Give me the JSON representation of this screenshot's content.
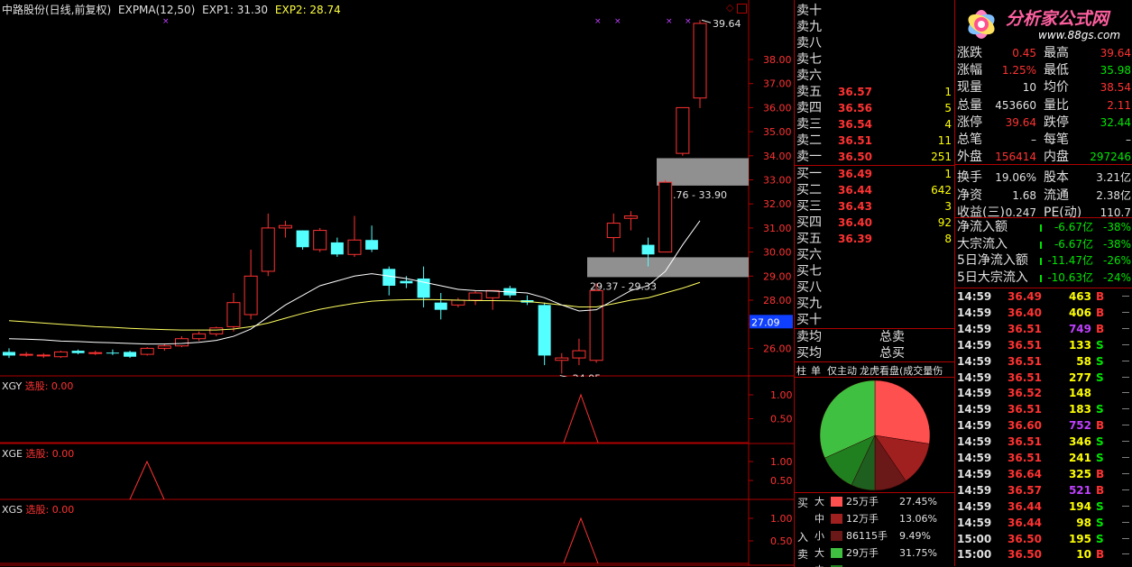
{
  "header": {
    "stock": "中路股份(日线,前复权)",
    "indicator": "EXPMA(12,50)",
    "exp1": "EXP1: 31.30",
    "exp2": "EXP2: 28.74"
  },
  "chart": {
    "price_ticks": [
      "38.00",
      "37.00",
      "36.00",
      "35.00",
      "34.00",
      "33.00",
      "32.00",
      "31.00",
      "30.00",
      "29.00",
      "28.00",
      "27.00",
      "26.00"
    ],
    "last_price_tag": "27.09",
    "annotations": {
      "high": "39.64",
      "low": "24.95",
      "zone1": "32.76 - 33.90",
      "zone2": "29.37 - 29.33"
    }
  },
  "subcharts": [
    {
      "name": "XGY",
      "label": "选股: 0.00",
      "ticks": [
        "1.00",
        "0.50"
      ]
    },
    {
      "name": "XGE",
      "label": "选股: 0.00",
      "ticks": [
        "1.00",
        "0.50"
      ]
    },
    {
      "name": "XGS",
      "label": "选股: 0.00",
      "ticks": [
        "1.00",
        "0.50"
      ]
    }
  ],
  "orderbook": {
    "sells": [
      {
        "label": "卖十",
        "price": "",
        "vol": ""
      },
      {
        "label": "卖九",
        "price": "",
        "vol": ""
      },
      {
        "label": "卖八",
        "price": "",
        "vol": ""
      },
      {
        "label": "卖七",
        "price": "",
        "vol": ""
      },
      {
        "label": "卖六",
        "price": "",
        "vol": ""
      },
      {
        "label": "卖五",
        "price": "36.57",
        "vol": "1"
      },
      {
        "label": "卖四",
        "price": "36.56",
        "vol": "5"
      },
      {
        "label": "卖三",
        "price": "36.54",
        "vol": "4"
      },
      {
        "label": "卖二",
        "price": "36.51",
        "vol": "11"
      },
      {
        "label": "卖一",
        "price": "36.50",
        "vol": "251"
      }
    ],
    "buys": [
      {
        "label": "买一",
        "price": "36.49",
        "vol": "1"
      },
      {
        "label": "买二",
        "price": "36.44",
        "vol": "642"
      },
      {
        "label": "买三",
        "price": "36.43",
        "vol": "3"
      },
      {
        "label": "买四",
        "price": "36.40",
        "vol": "92"
      },
      {
        "label": "买五",
        "price": "36.39",
        "vol": "8"
      },
      {
        "label": "买六",
        "price": "",
        "vol": ""
      },
      {
        "label": "买七",
        "price": "",
        "vol": ""
      },
      {
        "label": "买八",
        "price": "",
        "vol": ""
      },
      {
        "label": "买九",
        "price": "",
        "vol": ""
      },
      {
        "label": "买十",
        "price": "",
        "vol": ""
      }
    ],
    "avg": [
      {
        "label": "卖均",
        "total": "总卖"
      },
      {
        "label": "买均",
        "total": "总买"
      }
    ],
    "tabs": [
      "柱",
      "单",
      "仅主动",
      "龙虎看盘(成交量伤"
    ]
  },
  "pie": {
    "buy_label": "买",
    "in_label": "入",
    "sell_label": "卖",
    "legend": [
      {
        "size": "大",
        "name": "25万手",
        "pct": "27.45%",
        "color": "#ff5050"
      },
      {
        "size": "中",
        "name": "12万手",
        "pct": "13.06%",
        "color": "#a02020"
      },
      {
        "size": "小",
        "name": "86115手",
        "pct": "9.49%",
        "color": "#6a1818"
      },
      {
        "size": "大",
        "name": "29万手",
        "pct": "31.75%",
        "color": "#40c040"
      },
      {
        "size": "中",
        "name": "",
        "pct": "",
        "color": "#208020"
      }
    ],
    "slices": [
      27.45,
      13.06,
      9.49,
      7.0,
      11.25,
      31.75
    ]
  },
  "logo": {
    "text": "分析家公式网",
    "url": "www.88gs.com"
  },
  "stats": [
    {
      "l1": "涨跌",
      "v1": "0.45",
      "l2": "最高",
      "v2": "39.64",
      "c1": "red",
      "c2": "red"
    },
    {
      "l1": "涨幅",
      "v1": "1.25%",
      "l2": "最低",
      "v2": "35.98",
      "c1": "red",
      "c2": "green"
    },
    {
      "l1": "现量",
      "v1": "10",
      "l2": "均价",
      "v2": "38.54",
      "c1": "white",
      "c2": "red"
    },
    {
      "l1": "总量",
      "v1": "453660",
      "l2": "量比",
      "v2": "2.11",
      "c1": "white",
      "c2": "red"
    },
    {
      "l1": "涨停",
      "v1": "39.64",
      "l2": "跌停",
      "v2": "32.44",
      "c1": "red",
      "c2": "green"
    },
    {
      "l1": "总笔",
      "v1": "–",
      "l2": "每笔",
      "v2": "–",
      "c1": "white",
      "c2": "white"
    },
    {
      "l1": "外盘",
      "v1": "156414",
      "l2": "内盘",
      "v2": "297246",
      "c1": "red",
      "c2": "green"
    },
    {
      "l1": "换手",
      "v1": "19.06%",
      "l2": "股本",
      "v2": "3.21亿",
      "c1": "white",
      "c2": "white"
    },
    {
      "l1": "净资",
      "v1": "1.68",
      "l2": "流通",
      "v2": "2.38亿",
      "c1": "white",
      "c2": "white"
    },
    {
      "l1": "收益(三)",
      "v1": "0.247",
      "l2": "PE(动)",
      "v2": "110.7",
      "c1": "white",
      "c2": "white"
    }
  ],
  "flows": [
    {
      "label": "净流入额",
      "value": "-6.67亿",
      "pct": "-38%"
    },
    {
      "label": "大宗流入",
      "value": "-6.67亿",
      "pct": "-38%"
    },
    {
      "label": "5日净流入额",
      "value": "-11.47亿",
      "pct": "-26%"
    },
    {
      "label": "5日大宗流入",
      "value": "-10.63亿",
      "pct": "-24%"
    }
  ],
  "ticks": [
    {
      "t": "14:59",
      "p": "36.49",
      "v": "463",
      "s": "B",
      "pc": "red",
      "vc": "yellow"
    },
    {
      "t": "14:59",
      "p": "36.40",
      "v": "406",
      "s": "B",
      "pc": "red",
      "vc": "yellow"
    },
    {
      "t": "14:59",
      "p": "36.51",
      "v": "749",
      "s": "B",
      "pc": "red",
      "vc": "magenta"
    },
    {
      "t": "14:59",
      "p": "36.51",
      "v": "133",
      "s": "S",
      "pc": "red",
      "vc": "yellow"
    },
    {
      "t": "14:59",
      "p": "36.51",
      "v": "58",
      "s": "S",
      "pc": "red",
      "vc": "yellow"
    },
    {
      "t": "14:59",
      "p": "36.51",
      "v": "277",
      "s": "S",
      "pc": "red",
      "vc": "yellow"
    },
    {
      "t": "14:59",
      "p": "36.52",
      "v": "148",
      "s": "",
      "pc": "red",
      "vc": "yellow"
    },
    {
      "t": "14:59",
      "p": "36.51",
      "v": "183",
      "s": "S",
      "pc": "red",
      "vc": "yellow"
    },
    {
      "t": "14:59",
      "p": "36.60",
      "v": "752",
      "s": "B",
      "pc": "red",
      "vc": "magenta"
    },
    {
      "t": "14:59",
      "p": "36.51",
      "v": "346",
      "s": "S",
      "pc": "red",
      "vc": "yellow"
    },
    {
      "t": "14:59",
      "p": "36.51",
      "v": "241",
      "s": "S",
      "pc": "red",
      "vc": "yellow"
    },
    {
      "t": "14:59",
      "p": "36.64",
      "v": "325",
      "s": "B",
      "pc": "red",
      "vc": "yellow"
    },
    {
      "t": "14:59",
      "p": "36.57",
      "v": "521",
      "s": "B",
      "pc": "red",
      "vc": "magenta"
    },
    {
      "t": "14:59",
      "p": "36.44",
      "v": "194",
      "s": "S",
      "pc": "red",
      "vc": "yellow"
    },
    {
      "t": "14:59",
      "p": "36.44",
      "v": "98",
      "s": "S",
      "pc": "red",
      "vc": "yellow"
    },
    {
      "t": "15:00",
      "p": "36.50",
      "v": "195",
      "s": "S",
      "pc": "red",
      "vc": "yellow"
    },
    {
      "t": "15:00",
      "p": "36.50",
      "v": "10",
      "s": "B",
      "pc": "red",
      "vc": "yellow"
    }
  ],
  "candles": [
    {
      "o": 25.85,
      "h": 26.0,
      "l": 25.6,
      "c": 25.7
    },
    {
      "o": 25.75,
      "h": 25.85,
      "l": 25.65,
      "c": 25.75
    },
    {
      "o": 25.7,
      "h": 25.8,
      "l": 25.6,
      "c": 25.72
    },
    {
      "o": 25.65,
      "h": 25.9,
      "l": 25.6,
      "c": 25.85
    },
    {
      "o": 25.9,
      "h": 25.95,
      "l": 25.75,
      "c": 25.8
    },
    {
      "o": 25.8,
      "h": 25.9,
      "l": 25.72,
      "c": 25.82
    },
    {
      "o": 25.82,
      "h": 25.95,
      "l": 25.72,
      "c": 25.8
    },
    {
      "o": 25.85,
      "h": 25.9,
      "l": 25.6,
      "c": 25.65
    },
    {
      "o": 25.75,
      "h": 26.05,
      "l": 25.7,
      "c": 26.0
    },
    {
      "o": 26.0,
      "h": 26.2,
      "l": 25.9,
      "c": 26.1
    },
    {
      "o": 26.1,
      "h": 26.5,
      "l": 26.05,
      "c": 26.4
    },
    {
      "o": 26.4,
      "h": 26.7,
      "l": 26.3,
      "c": 26.6
    },
    {
      "o": 26.6,
      "h": 26.9,
      "l": 26.5,
      "c": 26.85
    },
    {
      "o": 26.9,
      "h": 28.3,
      "l": 26.7,
      "c": 27.9
    },
    {
      "o": 27.4,
      "h": 30.1,
      "l": 27.2,
      "c": 29.0
    },
    {
      "o": 29.2,
      "h": 31.6,
      "l": 29.0,
      "c": 31.0
    },
    {
      "o": 31.0,
      "h": 31.3,
      "l": 30.6,
      "c": 31.1
    },
    {
      "o": 30.9,
      "h": 30.9,
      "l": 30.1,
      "c": 30.2
    },
    {
      "o": 30.1,
      "h": 31.0,
      "l": 30.0,
      "c": 30.9
    },
    {
      "o": 30.4,
      "h": 30.6,
      "l": 29.8,
      "c": 29.9
    },
    {
      "o": 29.9,
      "h": 31.5,
      "l": 29.8,
      "c": 30.5
    },
    {
      "o": 30.5,
      "h": 31.1,
      "l": 30.0,
      "c": 30.1
    },
    {
      "o": 29.3,
      "h": 29.4,
      "l": 28.2,
      "c": 28.6
    },
    {
      "o": 28.8,
      "h": 29.0,
      "l": 28.5,
      "c": 28.7
    },
    {
      "o": 28.9,
      "h": 29.4,
      "l": 27.7,
      "c": 28.1
    },
    {
      "o": 27.9,
      "h": 28.3,
      "l": 27.2,
      "c": 27.6
    },
    {
      "o": 27.8,
      "h": 28.1,
      "l": 27.7,
      "c": 28.0
    },
    {
      "o": 28.0,
      "h": 28.4,
      "l": 27.8,
      "c": 28.3
    },
    {
      "o": 28.1,
      "h": 28.3,
      "l": 27.6,
      "c": 28.4
    },
    {
      "o": 28.5,
      "h": 28.6,
      "l": 28.1,
      "c": 28.2
    },
    {
      "o": 28.0,
      "h": 28.2,
      "l": 27.8,
      "c": 27.9
    },
    {
      "o": 27.8,
      "h": 27.9,
      "l": 25.3,
      "c": 25.7
    },
    {
      "o": 25.5,
      "h": 25.8,
      "l": 24.95,
      "c": 25.6
    },
    {
      "o": 25.6,
      "h": 26.4,
      "l": 25.3,
      "c": 25.9
    },
    {
      "o": 25.5,
      "h": 28.7,
      "l": 25.4,
      "c": 28.4
    },
    {
      "o": 30.6,
      "h": 31.6,
      "l": 30.0,
      "c": 31.2
    },
    {
      "o": 31.4,
      "h": 31.7,
      "l": 30.9,
      "c": 31.5
    },
    {
      "o": 30.3,
      "h": 30.6,
      "l": 29.4,
      "c": 29.9
    },
    {
      "o": 30.0,
      "h": 33.0,
      "l": 30.0,
      "c": 32.9
    },
    {
      "o": 34.1,
      "h": 35.6,
      "l": 34.0,
      "c": 36.0
    },
    {
      "o": 36.4,
      "h": 39.64,
      "l": 35.98,
      "c": 39.5
    }
  ],
  "ma_fast": [
    26.4,
    26.38,
    26.35,
    26.3,
    26.28,
    26.25,
    26.23,
    26.2,
    26.18,
    26.18,
    26.2,
    26.25,
    26.33,
    26.5,
    26.8,
    27.3,
    27.8,
    28.2,
    28.6,
    28.8,
    29.0,
    29.1,
    29.0,
    28.9,
    28.75,
    28.6,
    28.45,
    28.4,
    28.38,
    28.34,
    28.3,
    28.1,
    27.8,
    27.55,
    27.6,
    28.0,
    28.4,
    28.6,
    29.2,
    30.3,
    31.3
  ],
  "ma_slow": [
    27.15,
    27.1,
    27.05,
    27.0,
    26.95,
    26.9,
    26.87,
    26.83,
    26.8,
    26.78,
    26.76,
    26.76,
    26.76,
    26.8,
    26.9,
    27.05,
    27.25,
    27.45,
    27.62,
    27.75,
    27.87,
    27.96,
    28.0,
    28.02,
    28.03,
    28.02,
    28.0,
    27.98,
    27.98,
    27.97,
    27.95,
    27.88,
    27.8,
    27.72,
    27.72,
    27.85,
    28.0,
    28.1,
    28.3,
    28.5,
    28.74
  ]
}
